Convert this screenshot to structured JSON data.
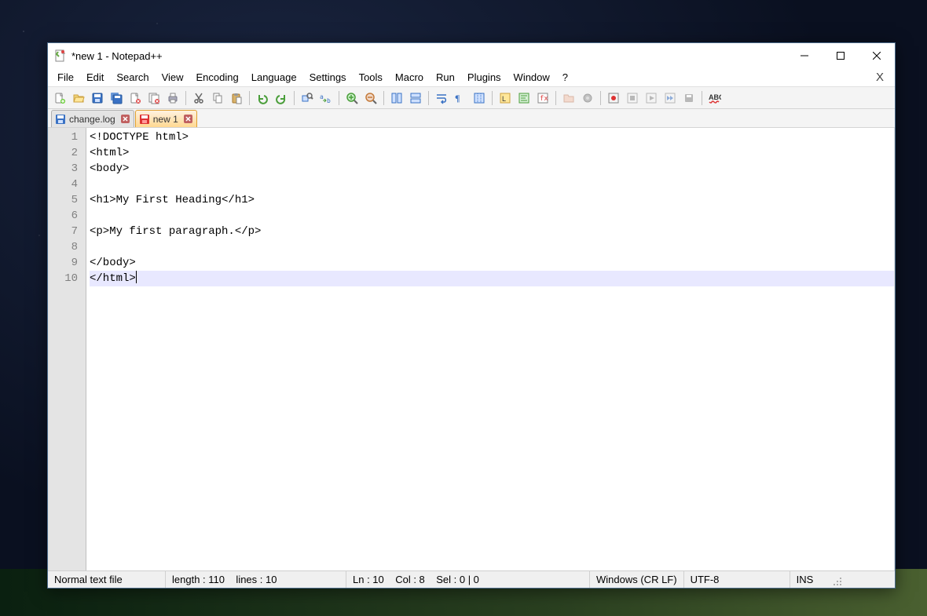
{
  "window": {
    "title": "*new 1 - Notepad++"
  },
  "menus": [
    "File",
    "Edit",
    "Search",
    "View",
    "Encoding",
    "Language",
    "Settings",
    "Tools",
    "Macro",
    "Run",
    "Plugins",
    "Window",
    "?"
  ],
  "toolbar_icons": [
    "new-file",
    "open-file",
    "save",
    "save-all",
    "close-file",
    "close-all",
    "print",
    "|",
    "cut",
    "copy",
    "paste",
    "|",
    "undo",
    "redo",
    "|",
    "find",
    "replace",
    "|",
    "zoom-in",
    "zoom-out",
    "|",
    "sync-v",
    "sync-h",
    "|",
    "wrap",
    "show-all-chars",
    "indent-guide",
    "|",
    "udl",
    "doc-map",
    "func-list",
    "|",
    "folder",
    "project",
    "|",
    "record-macro",
    "stop-macro",
    "play-macro",
    "play-multi",
    "save-macro",
    "|",
    "spell-check"
  ],
  "tabs": [
    {
      "label": "change.log",
      "icon": "saved",
      "active": false
    },
    {
      "label": "new 1",
      "icon": "unsaved",
      "active": true
    }
  ],
  "editor": {
    "lines": [
      "<!DOCTYPE html>",
      "<html>",
      "<body>",
      "",
      "<h1>My First Heading</h1>",
      "",
      "<p>My first paragraph.</p>",
      "",
      "</body>",
      "</html>"
    ],
    "current_line": 10
  },
  "status": {
    "filetype": "Normal text file",
    "length_label": "length : 110    lines : 10",
    "position": "Ln : 10    Col : 8    Sel : 0 | 0",
    "eol": "Windows (CR LF)",
    "encoding": "UTF-8",
    "mode": "INS"
  }
}
